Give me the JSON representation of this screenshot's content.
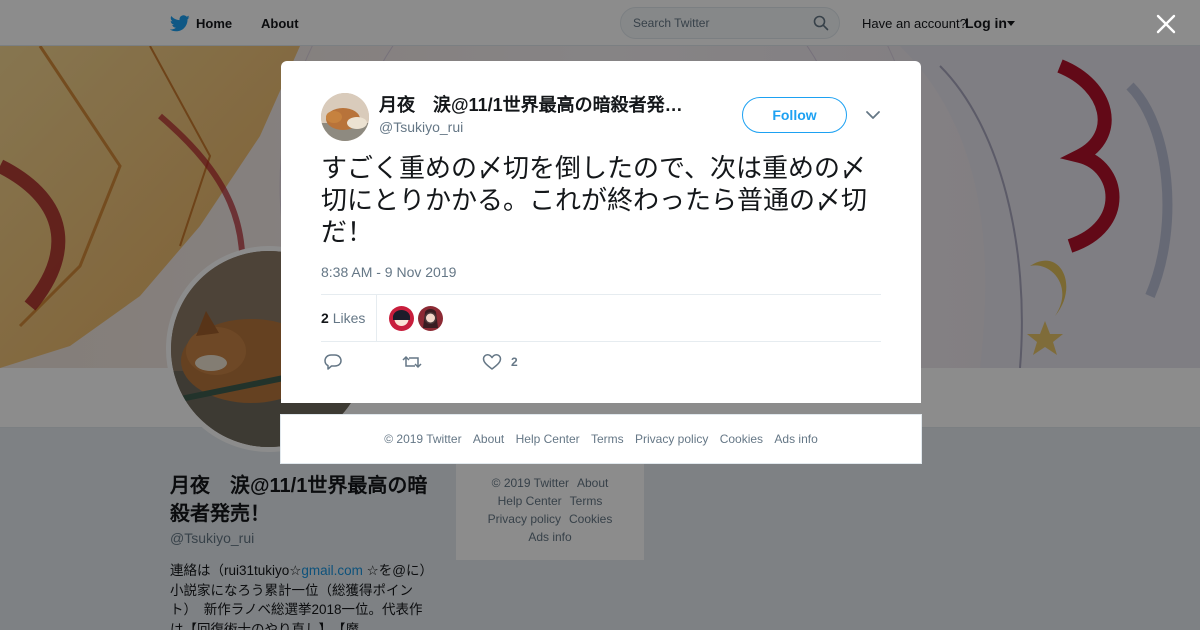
{
  "topbar": {
    "home_label": "Home",
    "about_label": "About",
    "search_placeholder": "Search Twitter",
    "have_account": "Have an account?",
    "login_label": "Log in"
  },
  "profile": {
    "name": "月夜　涙@11/1世界最高の暗殺者発売！",
    "handle": "@Tsukiyo_rui",
    "bio_prefix": "連絡は（rui31tukiyo☆",
    "bio_link": "gmail.com",
    "bio_suffix": " ☆を@に）小説家になろう累計一位（総獲得ポイント）　新作ラノベ総選挙2018一位。代表作は【回復術士のやり直し】、【魔"
  },
  "bg_footer": {
    "items": [
      "© 2019 Twitter",
      "About",
      "Help Center",
      "Terms",
      "Privacy policy",
      "Cookies",
      "Ads info"
    ]
  },
  "tweet": {
    "author_name": "月夜　涙@11/1世界最高の暗殺者発…",
    "author_handle": "@Tsukiyo_rui",
    "follow_label": "Follow",
    "text": "すごく重めの〆切を倒したので、次は重めの〆切にとりかかる。これが終わったら普通の〆切だ！",
    "timestamp": "8:38 AM - 9 Nov 2019",
    "likes_count": "2",
    "likes_label": "Likes",
    "like_action_count": "2"
  },
  "modal_footer": {
    "items": [
      "© 2019 Twitter",
      "About",
      "Help Center",
      "Terms",
      "Privacy policy",
      "Cookies",
      "Ads info"
    ]
  },
  "colors": {
    "accent": "#1da1f2",
    "link": "#1b95e0",
    "text_primary": "#14171a",
    "text_secondary": "#657786"
  },
  "icons": [
    "twitter-bird-icon",
    "home-icon",
    "search-icon",
    "caret-down-icon",
    "close-icon",
    "chevron-down-icon",
    "reply-icon",
    "retweet-icon",
    "heart-icon"
  ]
}
